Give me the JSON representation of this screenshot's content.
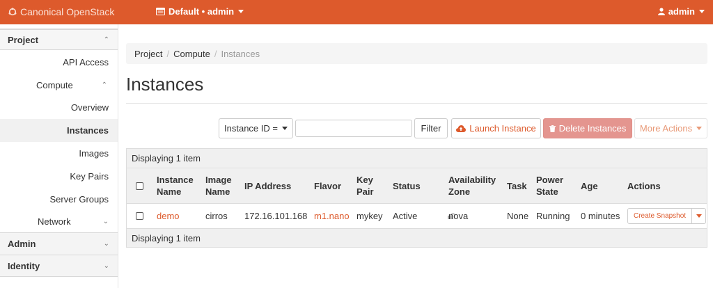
{
  "colors": {
    "brand": "#dd5a2c",
    "delete_button": "#e4958f",
    "link": "#dd5a2c"
  },
  "topbar": {
    "brand": "Canonical OpenStack",
    "context": "Default • admin",
    "user": "admin"
  },
  "sidebar": {
    "project": "Project",
    "api_access": "API Access",
    "compute": "Compute",
    "overview": "Overview",
    "instances": "Instances",
    "images": "Images",
    "key_pairs": "Key Pairs",
    "server_groups": "Server Groups",
    "network": "Network",
    "admin": "Admin",
    "identity": "Identity"
  },
  "breadcrumb": [
    "Project",
    "Compute",
    "Instances"
  ],
  "page_title": "Instances",
  "toolbar": {
    "filter_field": "Instance ID =",
    "filter_value": "",
    "filter_button": "Filter",
    "launch_button": "Launch Instance",
    "delete_button": "Delete Instances",
    "more_button": "More Actions"
  },
  "table": {
    "caption": "Displaying 1 item",
    "footer": "Displaying 1 item",
    "headers": {
      "instance_name": "Instance Name",
      "image_name": "Image Name",
      "ip_address": "IP Address",
      "flavor": "Flavor",
      "key_pair": "Key Pair",
      "status": "Status",
      "availability_zone": "Availability Zone",
      "task": "Task",
      "power_state": "Power State",
      "age": "Age",
      "actions": "Actions"
    },
    "rows": [
      {
        "instance_name": "demo",
        "image_name": "cirros",
        "ip_address": "172.16.101.168",
        "flavor": "m1.nano",
        "key_pair": "mykey",
        "status": "Active",
        "availability_zone": "nova",
        "task": "None",
        "power_state": "Running",
        "age": "0 minutes",
        "action": "Create Snapshot"
      }
    ]
  }
}
